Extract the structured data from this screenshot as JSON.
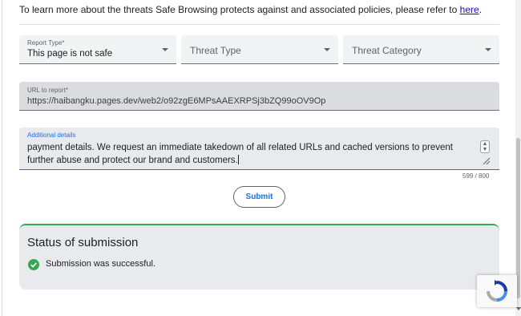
{
  "intro": {
    "text": "To learn more about the threats Safe Browsing protects against and associated policies, please refer to ",
    "link_label": "here",
    "suffix": "."
  },
  "form": {
    "report_type": {
      "label": "Report Type*",
      "value": "This page is not safe"
    },
    "threat_type": {
      "placeholder": "Threat Type"
    },
    "threat_category": {
      "placeholder": "Threat Category"
    },
    "url": {
      "label": "URL to report*",
      "value": "https://haibangku.pages.dev/web2/o92zgE6MPsAAEXRPSj3bZQ99oOV9Op"
    },
    "details": {
      "label": "Additional details",
      "value": "payment details. We request an immediate takedown of all related URLs and cached versions to prevent further abuse and protect our brand and customers.",
      "counter": "599 / 800"
    },
    "submit_label": "Submit"
  },
  "status": {
    "title": "Status of submission",
    "message": "Submission was successful."
  },
  "icons": {
    "success": "check-circle-icon",
    "recaptcha": "recaptcha-logo-icon",
    "dropdown": "caret-down-icon"
  },
  "colors": {
    "accent": "#1a73e8",
    "success": "#34a853",
    "field_bg": "#f1f3f4",
    "status_bg": "#e8eaed"
  }
}
